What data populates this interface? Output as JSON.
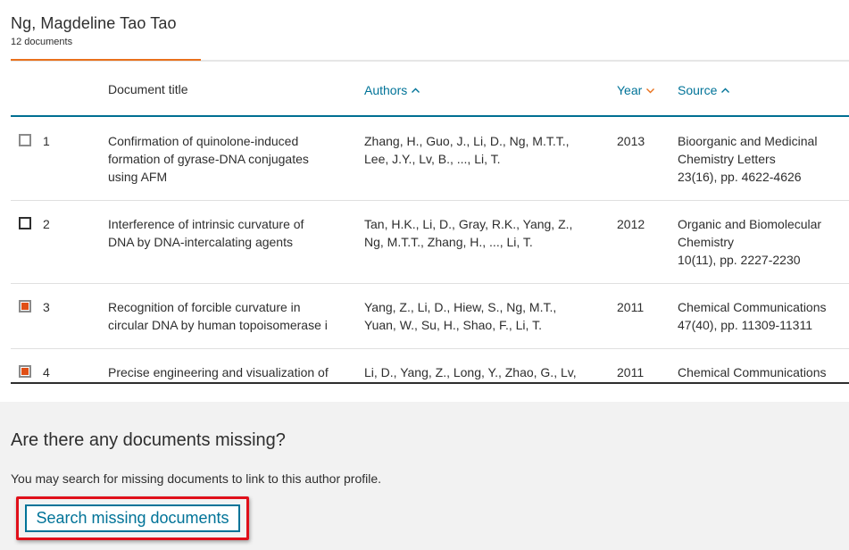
{
  "author": {
    "name": "Ng, Magdeline Tao Tao",
    "doc_count": "12 documents"
  },
  "table": {
    "columns": {
      "title": "Document title",
      "authors": "Authors",
      "year": "Year",
      "source": "Source"
    },
    "sort_indicators": {
      "authors": "chevron-up-icon",
      "year": "chevron-down-icon",
      "source": "chevron-up-icon"
    },
    "rows": [
      {
        "num": "1",
        "checked": false,
        "title": [
          "Confirmation of quinolone-induced",
          "formation of gyrase-DNA conjugates",
          "using AFM"
        ],
        "authors": [
          "Zhang, H., Guo, J., Li, D., Ng, M.T.T.,",
          "Lee, J.Y., Lv, B., ..., Li, T."
        ],
        "year": "2013",
        "source": [
          "Bioorganic and Medicinal",
          "Chemistry Letters",
          "23(16), pp. 4622-4626"
        ]
      },
      {
        "num": "2",
        "checked": false,
        "title": [
          "Interference of intrinsic curvature of",
          "DNA by DNA-intercalating agents"
        ],
        "authors": [
          "Tan, H.K., Li, D., Gray, R.K., Yang, Z.,",
          "Ng, M.T.T., Zhang, H., ..., Li, T."
        ],
        "year": "2012",
        "source": [
          "Organic and Biomolecular",
          "Chemistry",
          "10(11), pp. 2227-2230"
        ]
      },
      {
        "num": "3",
        "checked": true,
        "title": [
          "Recognition of forcible curvature in",
          "circular DNA by human topoisomerase i"
        ],
        "authors": [
          "Yang, Z., Li, D., Hiew, S., Ng, M.T.,",
          "Yuan, W., Su, H., Shao, F., Li, T."
        ],
        "year": "2011",
        "source": [
          "Chemical Communications",
          "47(40), pp. 11309-11311"
        ]
      },
      {
        "num": "4",
        "checked": true,
        "title": [
          "Precise engineering and visualization of"
        ],
        "authors": [
          "Li, D., Yang, Z., Long, Y., Zhao, G., Lv,"
        ],
        "year": "2011",
        "source": [
          "Chemical Communications"
        ]
      }
    ]
  },
  "missing": {
    "title": "Are there any documents missing?",
    "text": "You may search for missing documents to link to this author profile.",
    "button_label": "Search missing documents"
  },
  "colors": {
    "link": "#007398",
    "accent": "#e9711c",
    "checkbox_fill": "#e04f16",
    "highlight": "#e0101a"
  }
}
